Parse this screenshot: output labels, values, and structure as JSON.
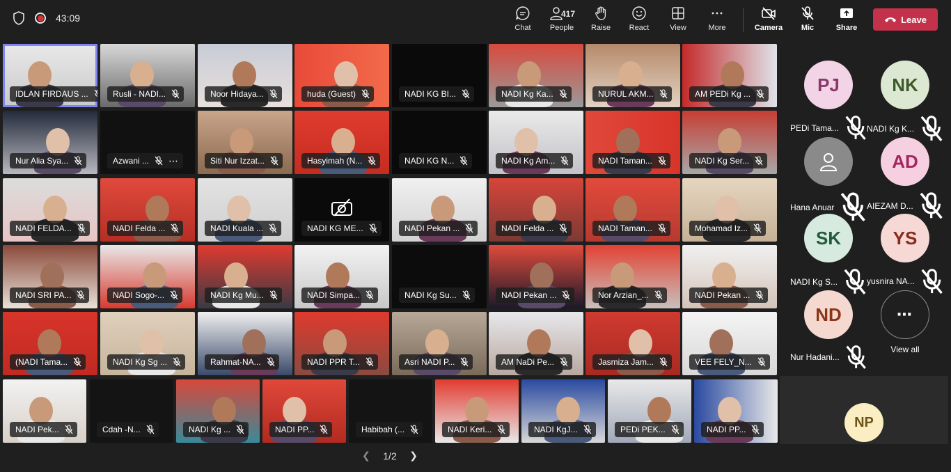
{
  "meeting": {
    "timer": "43:09"
  },
  "toolbar": {
    "chat": "Chat",
    "people": "People",
    "people_count": "417",
    "raise": "Raise",
    "react": "React",
    "view": "View",
    "more": "More",
    "camera": "Camera",
    "mic": "Mic",
    "share": "Share",
    "leave": "Leave"
  },
  "tiles": [
    "IDLAN FIRDAUS ...",
    "Rusli - NADI...",
    "Noor Hidaya...",
    "huda (Guest)",
    "NADI KG BI...",
    "NADI Kg Ka...",
    "NURUL AKM...",
    "AM PEDi Kg ...",
    "Nur Alia Sya...",
    "Azwani ...",
    "Siti Nur Izzat...",
    "Hasyimah (N...",
    "NADI KG N...",
    "NADI Kg Am...",
    "NADI Taman...",
    "NADI Kg Ser...",
    "NADI FELDA...",
    "NADI Felda ...",
    "NADI Kuala ...",
    "NADI KG ME...",
    "NADI Pekan ...",
    "NADI Felda ...",
    "NADI Taman...",
    "Mohamad Iz...",
    "NADI SRI PA...",
    "NADI Sogo-...",
    "NADI Kg Mu...",
    "NADI Simpa...",
    "NADI Kg Su...",
    "NADI Pekan ...",
    "Nor Arzian_...",
    "NADI Pekan ...",
    "(NADI Tama...",
    "NADI Kg Sg ...",
    "Rahmat-NA...",
    "NADI PPR T...",
    "Asri NADI P...",
    "AM NaDi Pe...",
    "Jasmiza Jam...",
    "VEE FELY_N...",
    "NADI Pek...",
    "Cdah -N...",
    "NADI Kg ...",
    "NADI PP...",
    "Habibah (...",
    "NADI Keri...",
    "NADI KgJ...",
    "PEDi PEK...",
    "NADI PP..."
  ],
  "sidebar": [
    {
      "initials": "PJ",
      "name": "PEDi Tama...",
      "bg": "#f2d4e6",
      "fg": "#8a3a6a"
    },
    {
      "initials": "NK",
      "name": "NADI Kg K...",
      "bg": "#dde8d2",
      "fg": "#3d5a2a"
    },
    {
      "initials": "",
      "name": "Hana Anuar",
      "bg": "#8a8a8a",
      "fg": "#ffffff"
    },
    {
      "initials": "AD",
      "name": "AIEZAM D...",
      "bg": "#f6d0e0",
      "fg": "#a4265e"
    },
    {
      "initials": "SK",
      "name": "NADI Kg S...",
      "bg": "#d6eadf",
      "fg": "#235a3c"
    },
    {
      "initials": "YS",
      "name": "yusnira NA...",
      "bg": "#f6d8d4",
      "fg": "#8a2a1e"
    },
    {
      "initials": "ND",
      "name": "Nur Hadani...",
      "bg": "#f5d9d0",
      "fg": "#8a3519"
    },
    {
      "initials": "",
      "name": "View all",
      "bg": "#1f1f1f",
      "fg": "#ffffff"
    }
  ],
  "self": {
    "initials": "NP"
  },
  "pager": {
    "label": "1/2"
  }
}
